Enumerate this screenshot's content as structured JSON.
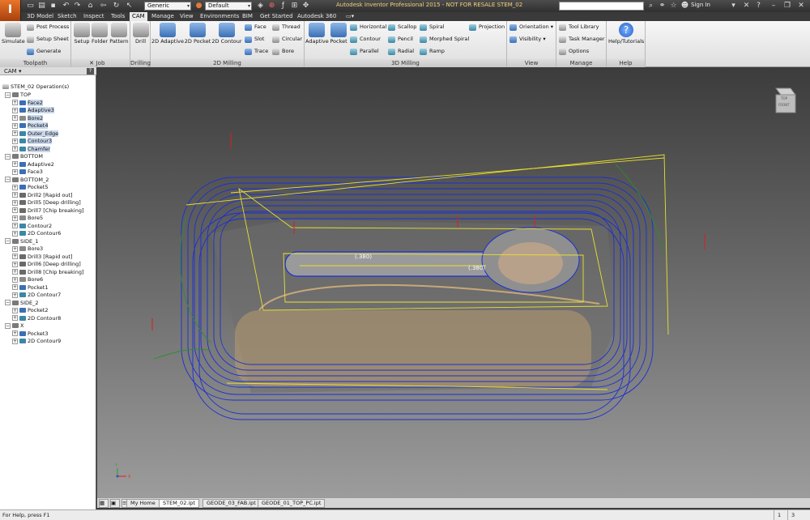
{
  "app": {
    "letter": "I"
  },
  "qat": {
    "style_combo": "Generic",
    "material_combo": "Default",
    "title": "Autodesk Inventor Professional 2015 - NOT FOR RESALE    STEM_02",
    "sign_in": "Sign In"
  },
  "tabs": [
    "3D Model",
    "Sketch",
    "Inspect",
    "Tools",
    "CAM",
    "Manage",
    "View",
    "Environments",
    "BIM",
    "Get Started",
    "Autodesk 360"
  ],
  "ribbon": {
    "toolpath": {
      "label": "Toolpath",
      "simulate": "Simulate",
      "post_process": "Post Process",
      "setup_sheet": "Setup Sheet",
      "generate": "Generate"
    },
    "job": {
      "label": "Job",
      "setup": "Setup",
      "folder": "Folder",
      "pattern": "Pattern"
    },
    "drilling": {
      "label": "Drilling",
      "drill": "Drill"
    },
    "milling2d": {
      "label": "2D Milling",
      "adaptive": "2D Adaptive",
      "pocket": "2D Pocket",
      "contour": "2D Contour",
      "face": "Face",
      "slot": "Slot",
      "trace": "Trace",
      "thread": "Thread",
      "circular": "Circular",
      "bore": "Bore"
    },
    "milling3d": {
      "label": "3D Milling",
      "adaptive": "Adaptive",
      "pocket": "Pocket",
      "horizontal": "Horizontal",
      "contour": "Contour",
      "parallel": "Parallel",
      "scallop": "Scallop",
      "pencil": "Pencil",
      "radial": "Radial",
      "spiral": "Spiral",
      "morphed_spiral": "Morphed Spiral",
      "ramp": "Ramp",
      "projection": "Projection"
    },
    "view": {
      "label": "View",
      "orientation": "Orientation",
      "visibility": "Visibility"
    },
    "manage": {
      "label": "Manage",
      "tool_library": "Tool Library",
      "task_manager": "Task Manager",
      "options": "Options"
    },
    "help": {
      "label": "Help",
      "help_tutorials": "Help/Tutorials"
    }
  },
  "browser": {
    "title": "CAM ▾",
    "help": "?",
    "root": "STEM_02 Operation(s)",
    "items": [
      {
        "label": "TOP",
        "level": 1,
        "icon": "setup",
        "hl": false
      },
      {
        "label": "Face2",
        "level": 2,
        "icon": "face",
        "hl": true
      },
      {
        "label": "Adaptive3",
        "level": 2,
        "icon": "adaptive",
        "hl": true
      },
      {
        "label": "Bore2",
        "level": 2,
        "icon": "bore",
        "hl": true
      },
      {
        "label": "Pocket4",
        "level": 2,
        "icon": "pocket",
        "hl": true
      },
      {
        "label": "Outer_Edge",
        "level": 2,
        "icon": "contour",
        "hl": true
      },
      {
        "label": "Contour3",
        "level": 2,
        "icon": "contour",
        "hl": true
      },
      {
        "label": "Chamfer",
        "level": 2,
        "icon": "contour",
        "hl": true
      },
      {
        "label": "BOTTOM",
        "level": 1,
        "icon": "setup",
        "hl": false
      },
      {
        "label": "Adaptive2",
        "level": 2,
        "icon": "adaptive",
        "hl": false
      },
      {
        "label": "Face3",
        "level": 2,
        "icon": "face",
        "hl": false
      },
      {
        "label": "BOTTOM_2",
        "level": 1,
        "icon": "setup",
        "hl": false
      },
      {
        "label": "Pocket5",
        "level": 2,
        "icon": "pocket",
        "hl": false
      },
      {
        "label": "Drill2 [Rapid out]",
        "level": 2,
        "icon": "drill",
        "hl": false
      },
      {
        "label": "Drill5 [Deep drilling]",
        "level": 2,
        "icon": "drill",
        "hl": false
      },
      {
        "label": "Drill7 [Chip breaking]",
        "level": 2,
        "icon": "drill",
        "hl": false
      },
      {
        "label": "Bore5",
        "level": 2,
        "icon": "bore",
        "hl": false
      },
      {
        "label": "Contour2",
        "level": 2,
        "icon": "contour",
        "hl": false
      },
      {
        "label": "2D Contour6",
        "level": 2,
        "icon": "contour",
        "hl": false
      },
      {
        "label": "SIDE_1",
        "level": 1,
        "icon": "setup",
        "hl": false
      },
      {
        "label": "Bore3",
        "level": 2,
        "icon": "bore",
        "hl": false
      },
      {
        "label": "Drill3 [Rapid out]",
        "level": 2,
        "icon": "drill",
        "hl": false
      },
      {
        "label": "Drill6 [Deep drilling]",
        "level": 2,
        "icon": "drill",
        "hl": false
      },
      {
        "label": "Drill8 [Chip breaking]",
        "level": 2,
        "icon": "drill",
        "hl": false
      },
      {
        "label": "Bore6",
        "level": 2,
        "icon": "bore",
        "hl": false
      },
      {
        "label": "Pocket1",
        "level": 2,
        "icon": "pocket",
        "hl": false
      },
      {
        "label": "2D Contour7",
        "level": 2,
        "icon": "contour",
        "hl": false
      },
      {
        "label": "SIDE_2",
        "level": 1,
        "icon": "setup",
        "hl": false
      },
      {
        "label": "Pocket2",
        "level": 2,
        "icon": "pocket",
        "hl": false
      },
      {
        "label": "2D Contour8",
        "level": 2,
        "icon": "contour",
        "hl": false
      },
      {
        "label": "X",
        "level": 1,
        "icon": "setup",
        "hl": false
      },
      {
        "label": "Pocket3",
        "level": 2,
        "icon": "pocket",
        "hl": false
      },
      {
        "label": "2D Contour9",
        "level": 2,
        "icon": "contour",
        "hl": false
      }
    ]
  },
  "viewport": {
    "dim1": "(.380)",
    "dim2": "(.380)",
    "viewcube": {
      "top": "TOP",
      "front": "FRONT"
    },
    "triad": {
      "x": "X",
      "y": "Y"
    }
  },
  "doc_tabs": [
    "My Home",
    "STEM_02.ipt",
    "GEODE_03_FAB.ipt",
    "GEODE_01_TOP_PC.ipt"
  ],
  "status": {
    "text": "For Help, press F1",
    "c1": "1",
    "c2": "3"
  },
  "colors": {
    "ribbon_active": "#e9e9e9",
    "toolpath_blue": "#1a2fd6",
    "toolpath_yellow": "#e8e030",
    "toolpath_green": "#2e8c2e",
    "stock": "#b89a6e"
  }
}
